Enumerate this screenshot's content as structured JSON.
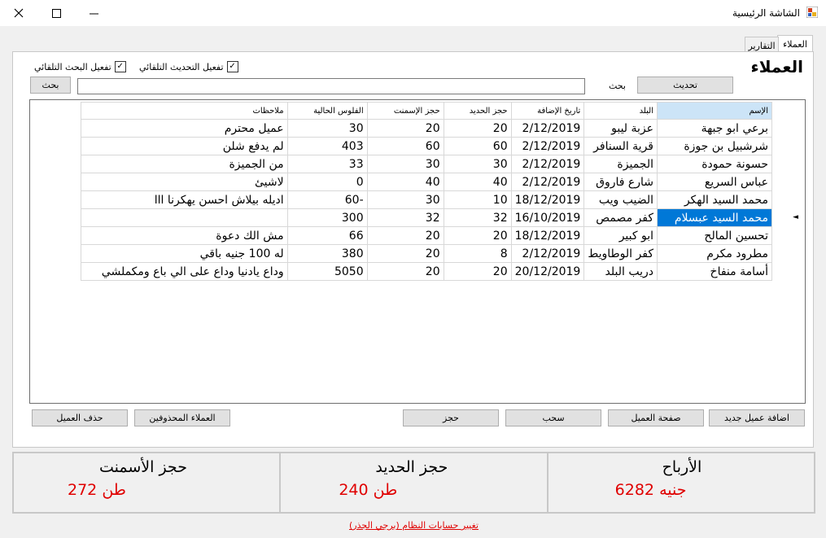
{
  "window": {
    "title": "الشاشة الرئيسية",
    "minimize_icon": "minimize-icon",
    "maximize_icon": "maximize-icon",
    "close_icon": "close-icon"
  },
  "tabs": [
    {
      "label": "العملاء",
      "selected": true
    },
    {
      "label": "التقارير",
      "selected": false
    }
  ],
  "heading": "العملاء",
  "options": {
    "auto_update_label": "تفعيل التحديث التلقائي",
    "auto_update_checked": true,
    "auto_search_label": "تفعيل البحث التلقائي",
    "auto_search_checked": true
  },
  "toolbar": {
    "refresh_label": "تحديث",
    "search_label": "بحث",
    "search_button_label": "بحث",
    "search_value": ""
  },
  "grid": {
    "columns": [
      "الإسم",
      "البلد",
      "تاريخ الإضافة",
      "حجز الحديد",
      "حجز الإسمنت",
      "الفلوس الحالية",
      "ملاحظات"
    ],
    "selected_row_index": 5,
    "rows": [
      [
        "برعي ابو جبهة",
        "عزبة ليبو",
        "2/12/2019",
        "20",
        "20",
        "30",
        "عميل محترم"
      ],
      [
        "شرشبيل بن جوزة",
        "قرية السنافر",
        "2/12/2019",
        "60",
        "60",
        "403",
        "لم يدفع شلن"
      ],
      [
        "حسونة حمودة",
        "الجميزة",
        "2/12/2019",
        "30",
        "30",
        "33",
        "من الجميزة"
      ],
      [
        "عباس السريع",
        "شارع فاروق",
        "2/12/2019",
        "40",
        "40",
        "0",
        "لاشيئ"
      ],
      [
        "محمد السيد الهكر",
        "الضيب ويب",
        "18/12/2019",
        "10",
        "30",
        "-60",
        "اديله بيلاش احسن يهكرنا ااا"
      ],
      [
        "محمد السيد عبسلام",
        "كفر مصمص",
        "16/10/2019",
        "32",
        "32",
        "300",
        ""
      ],
      [
        "تحسين المالح",
        "ابو كبير",
        "18/12/2019",
        "20",
        "20",
        "66",
        "مش الك دعوة"
      ],
      [
        "مطرود مكرم",
        "كفر الوطاويط",
        "2/12/2019",
        "8",
        "20",
        "380",
        "له 100 جنيه باقي"
      ],
      [
        "أسامة منفاخ",
        "دريب البلد",
        "20/12/2019",
        "20",
        "20",
        "5050",
        "وداع يادنيا وداع على الي باع ومكملشي"
      ]
    ]
  },
  "actions": {
    "add_customer": "اضافة عميل جديد",
    "customer_page": "صفحة العميل",
    "withdraw": "سحب",
    "reserve": "حجز",
    "deleted_customers": "العملاء المحذوفين",
    "delete_customer": "حذف العميل"
  },
  "stats": {
    "profits_title": "الأرباح",
    "profits_value": "6282 جنيه",
    "iron_title": "حجز الحديد",
    "iron_value": "240 طن",
    "cement_title": "حجز الأسمنت",
    "cement_value": "272 طن"
  },
  "footer_link": "تغيير حسابات النظام (برجي الجذر)",
  "colors": {
    "accent": "#0078d7",
    "stat_value": "#e00000"
  }
}
